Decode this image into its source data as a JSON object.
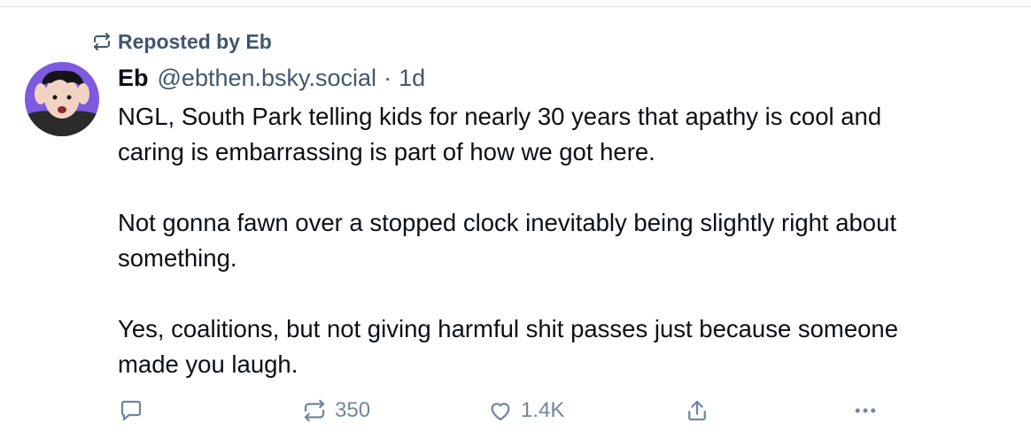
{
  "repost_banner": {
    "text": "Reposted by Eb",
    "icon": "repost-icon"
  },
  "post": {
    "author": {
      "display_name": "Eb",
      "handle": "@ebthen.bsky.social",
      "avatar": "avatar"
    },
    "separator": "·",
    "time": "1d",
    "paragraphs": [
      [
        "NGL, South Park telling kids for nearly 30 years that apathy is cool and",
        "caring is embarrassing is part of how we got here."
      ],
      [
        "Not gonna fawn over a stopped clock inevitably being slightly right about",
        "something."
      ],
      [
        "Yes, coalitions, but not giving harmful shit passes just because someone",
        "made you laugh."
      ]
    ]
  },
  "actions": {
    "reply": {
      "icon": "reply-icon",
      "count": ""
    },
    "repost": {
      "icon": "repost-icon",
      "count": "350"
    },
    "like": {
      "icon": "heart-icon",
      "count": "1.4K"
    },
    "share": {
      "icon": "share-icon"
    },
    "more": {
      "icon": "more-icon"
    }
  },
  "colors": {
    "text": "#0b0f14",
    "muted": "#42566b",
    "action": "#6f869f",
    "divider": "#d4dbe2"
  }
}
